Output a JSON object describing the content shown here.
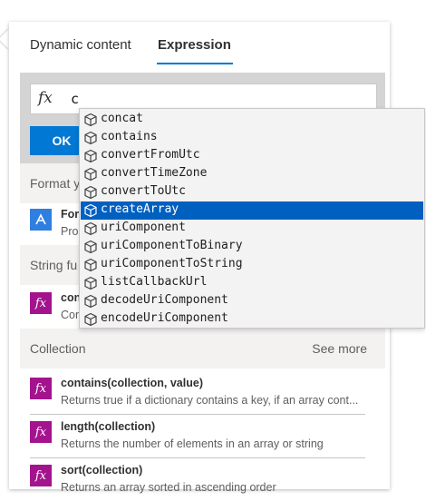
{
  "tabs": [
    {
      "label": "Dynamic content"
    },
    {
      "label": "Expression"
    }
  ],
  "active_tab": "Expression",
  "expression": {
    "fx_label": "fx",
    "value": "c"
  },
  "ok_button": {
    "label": "OK"
  },
  "sections": {
    "format": {
      "title": "Format y"
    },
    "string": {
      "title": "String fu"
    },
    "collection": {
      "title": "Collection",
      "see_more": "See more"
    }
  },
  "hidden_items": {
    "format_item": {
      "name": "For",
      "desc": "Pro"
    },
    "string_item": {
      "name": "con",
      "desc": "Con"
    }
  },
  "collection_items": [
    {
      "name": "contains(collection, value)",
      "desc": "Returns true if a dictionary contains a key, if an array cont..."
    },
    {
      "name": "length(collection)",
      "desc": "Returns the number of elements in an array or string"
    },
    {
      "name": "sort(collection)",
      "desc": "Returns an array sorted in ascending order"
    }
  ],
  "autocomplete": {
    "selected": "createArray",
    "items": [
      {
        "label": "concat"
      },
      {
        "label": "contains"
      },
      {
        "label": "convertFromUtc"
      },
      {
        "label": "convertTimeZone"
      },
      {
        "label": "convertToUtc"
      },
      {
        "label": "createArray"
      },
      {
        "label": "uriComponent"
      },
      {
        "label": "uriComponentToBinary"
      },
      {
        "label": "uriComponentToString"
      },
      {
        "label": "listCallbackUrl"
      },
      {
        "label": "decodeUriComponent"
      },
      {
        "label": "encodeUriComponent"
      }
    ]
  },
  "colors": {
    "accent": "#0078d4",
    "function_icon": "#a4138e",
    "format_icon": "#2f7fe0",
    "selection": "#0060c0"
  }
}
